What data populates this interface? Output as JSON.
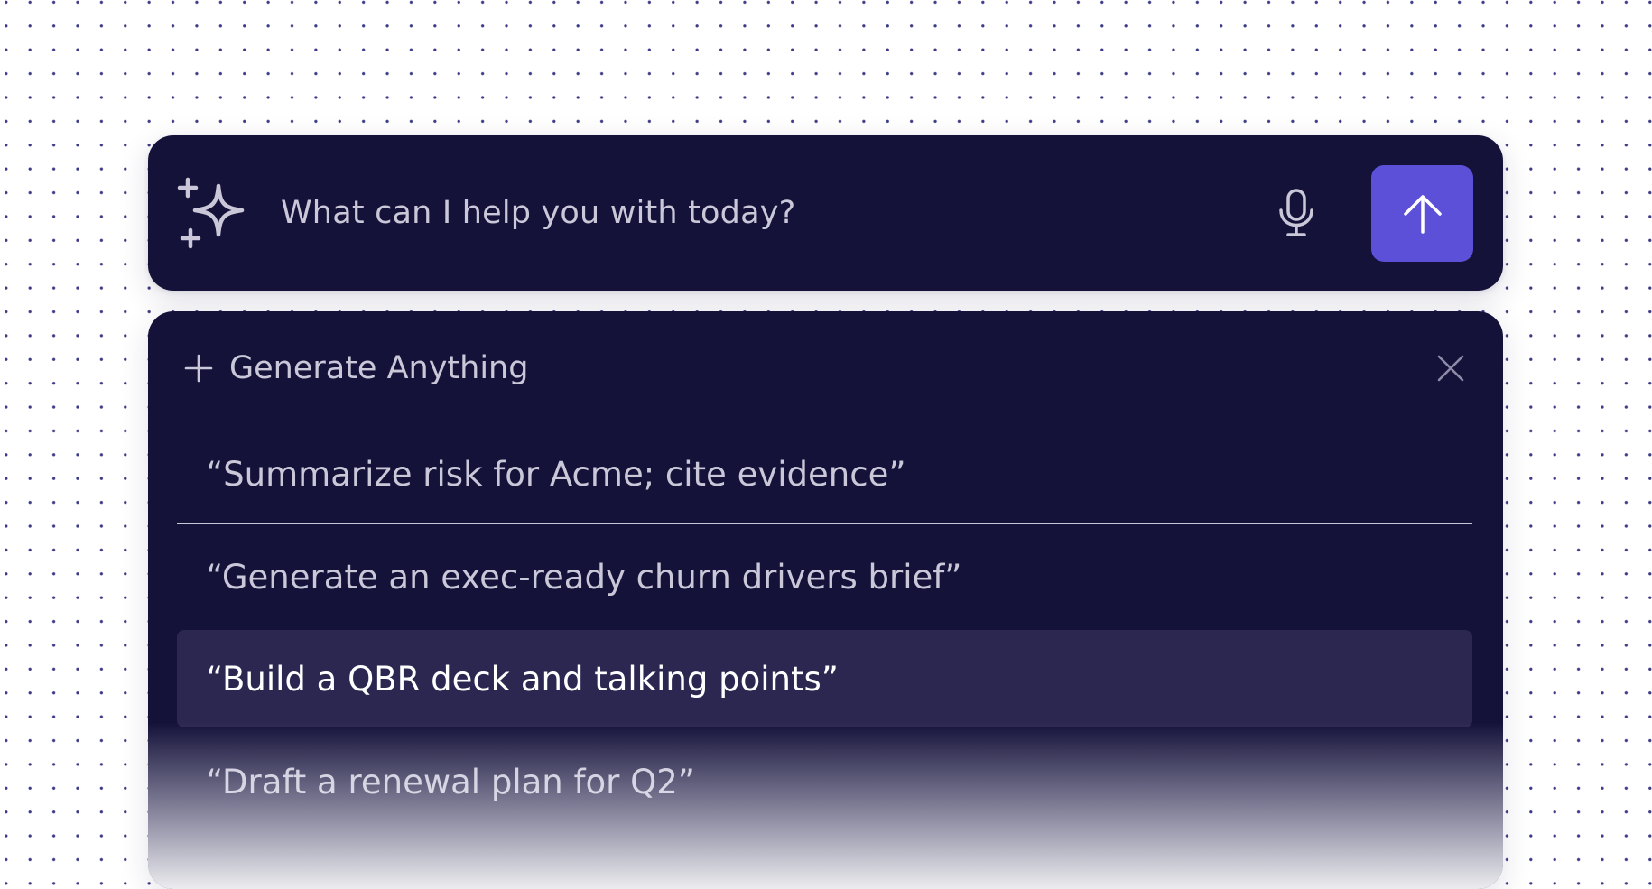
{
  "prompt": {
    "placeholder": "What can I help you with today?",
    "leading_icon": "sparkle-icon",
    "mic_icon": "microphone-icon",
    "send_icon": "arrow-up-icon"
  },
  "panel": {
    "title": "Generate Anything",
    "title_icon": "plus-icon",
    "close_icon": "close-icon",
    "suggestions": [
      "“Summarize risk for Acme; cite evidence”",
      "“Generate an exec-ready churn drivers brief”",
      "“Build a QBR deck and talking points”",
      "“Draft a renewal plan for Q2”"
    ],
    "highlighted_index": 2
  },
  "colors": {
    "surface": "#15123a",
    "accent": "#5c50d9",
    "highlight": "#2b2751",
    "text_muted": "#c9c7d8",
    "text_active": "#ffffff",
    "dot_grid": "#3c3a86"
  }
}
